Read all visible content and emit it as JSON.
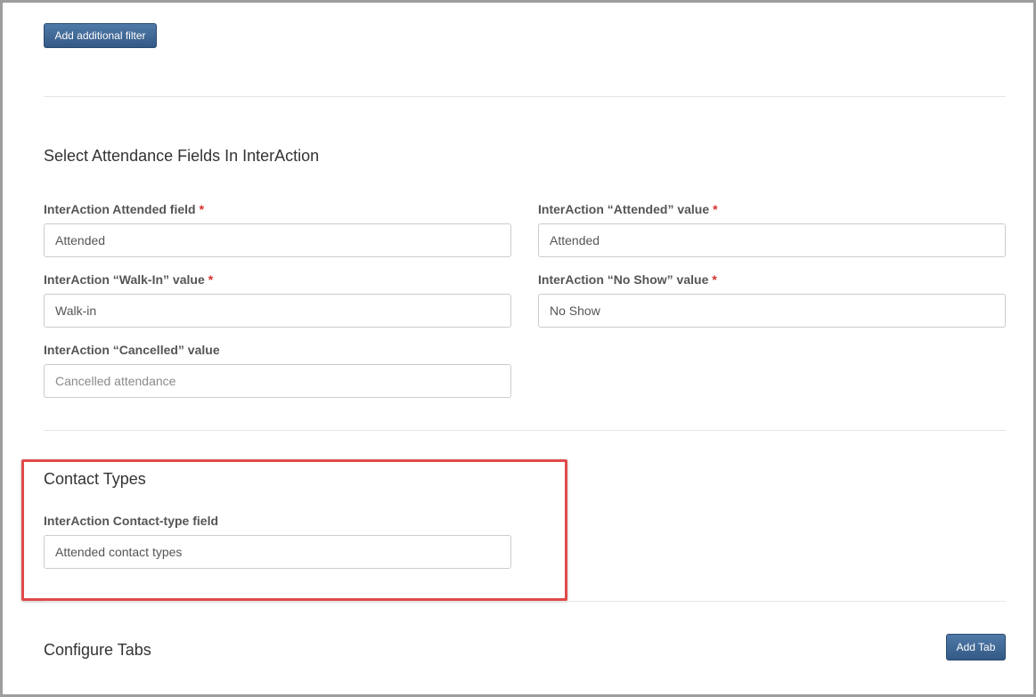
{
  "filters": {
    "add_filter_label": "Add additional filter"
  },
  "attendance": {
    "title": "Select Attendance Fields In InterAction",
    "required_marker": "*",
    "attended_field": {
      "label": "InterAction Attended field",
      "value": "Attended"
    },
    "attended_value": {
      "label": "InterAction “Attended” value",
      "value": "Attended"
    },
    "walkin_value": {
      "label": "InterAction “Walk-In” value",
      "value": "Walk-in"
    },
    "noshow_value": {
      "label": "InterAction “No Show” value",
      "value": "No Show"
    },
    "cancelled_value": {
      "label": "InterAction “Cancelled” value",
      "value": "",
      "placeholder": "Cancelled attendance"
    }
  },
  "contact_types": {
    "title": "Contact Types",
    "contact_type_field": {
      "label": "InterAction Contact-type field",
      "value": "Attended contact types"
    }
  },
  "tabs": {
    "title": "Configure Tabs",
    "add_tab_label": "Add Tab"
  },
  "colors": {
    "button": "#3f6894",
    "required": "#d9302c",
    "highlight": "#e04a4a"
  }
}
